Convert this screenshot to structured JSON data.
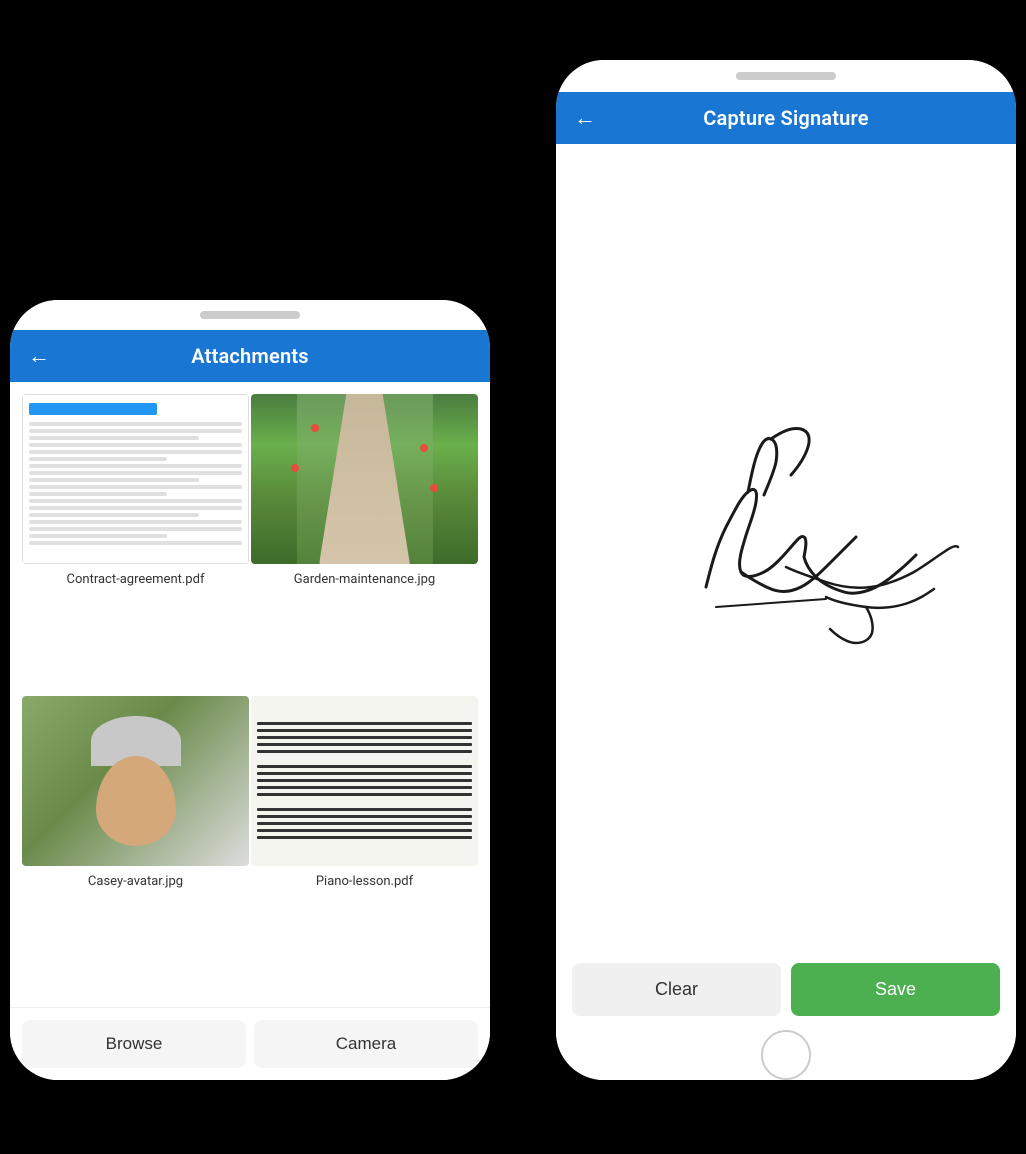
{
  "left_phone": {
    "header": {
      "back_label": "←",
      "title": "Attachments"
    },
    "attachments": [
      {
        "name": "Contract-agreement.pdf",
        "type": "document"
      },
      {
        "name": "Garden-maintenance.jpg",
        "type": "garden"
      },
      {
        "name": "Casey-avatar.jpg",
        "type": "avatar"
      },
      {
        "name": "Piano-lesson.pdf",
        "type": "music"
      }
    ],
    "buttons": [
      {
        "label": "Browse",
        "id": "browse"
      },
      {
        "label": "Camera",
        "id": "camera"
      }
    ]
  },
  "right_phone": {
    "header": {
      "back_label": "←",
      "title": "Capture Signature"
    },
    "buttons": {
      "clear": "Clear",
      "save": "Save"
    }
  }
}
